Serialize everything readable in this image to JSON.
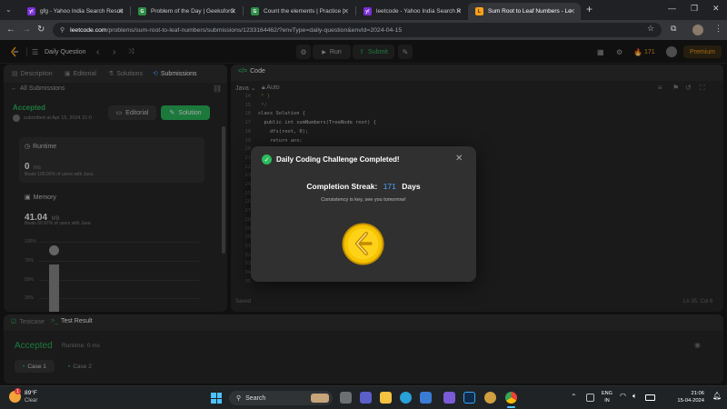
{
  "browser": {
    "tabs": [
      {
        "label": "gfg - Yahoo India Search Result",
        "fav_color": "#7b2fd6",
        "fav_text": "y!",
        "active": false
      },
      {
        "label": "Problem of the Day | GeeksforG",
        "fav_color": "#2f8d46",
        "fav_text": "G",
        "active": false
      },
      {
        "label": "Count the elements | Practice |",
        "fav_color": "#2f8d46",
        "fav_text": "G",
        "active": false
      },
      {
        "label": "leetcode - Yahoo India Search R",
        "fav_color": "#7b2fd6",
        "fav_text": "y!",
        "active": false
      },
      {
        "label": "Sum Root to Leaf Numbers - Le",
        "fav_color": "#ffa116",
        "fav_text": "L",
        "active": true
      }
    ],
    "new_tab": "+",
    "url_host": "leetcode.com",
    "url_path": "/problems/sum-root-to-leaf-numbers/submissions/1233164462/?envType=daily-question&envId=2024-04-15"
  },
  "lc_nav": {
    "daily_question": "Daily Question",
    "run": "Run",
    "submit": "Submit",
    "streak": "171",
    "premium": "Premium"
  },
  "left_panel": {
    "tabs": [
      "Description",
      "Editorial",
      "Solutions",
      "Submissions"
    ],
    "all_submissions": "All Submissions",
    "status": "Accepted",
    "submitted": "submitted at Apr 15, 2024 21:0",
    "editorial_btn": "Editorial",
    "solution_btn": "Solution",
    "runtime_label": "Runtime",
    "runtime_value": "0",
    "runtime_unit": "ms",
    "runtime_beats": "Beats 100.00% of users with Java",
    "memory_label": "Memory",
    "memory_value": "41.04",
    "memory_unit": "MB",
    "memory_beats": "Beats 50.97% of users with Java",
    "chart_ticks": [
      "100%",
      "75%",
      "50%",
      "25%"
    ]
  },
  "code_panel": {
    "title": "Code",
    "language": "Java",
    "auto": "Auto",
    "saved": "Saved",
    "cursor": "Ln 35, Col 6",
    "line_numbers": [
      "14",
      "15",
      "16",
      "17",
      "18",
      "19",
      "20",
      "21",
      "22",
      "23",
      "24",
      "25",
      "26",
      "27",
      "28",
      "29",
      "30",
      "31",
      "32",
      "33",
      "34",
      "35"
    ],
    "code_lines": [
      {
        "n": "14",
        "text": " * }"
      },
      {
        "n": "15",
        "text": " */"
      },
      {
        "n": "16",
        "text": "class Solution {"
      },
      {
        "n": "17",
        "text": "  public int sumNumbers(TreeNode root) {"
      },
      {
        "n": "18",
        "text": "    dfs(root, 0);"
      },
      {
        "n": "19",
        "text": "    return ans;"
      }
    ]
  },
  "bottom_panel": {
    "testcase_tab": "Testcase",
    "result_tab": "Test Result",
    "status": "Accepted",
    "runtime": "Runtime: 0 ms",
    "cases": [
      "Case 1",
      "Case 2"
    ]
  },
  "modal": {
    "title": "Daily Coding Challenge Completed!",
    "streak_label": "Completion Streak:",
    "streak_value": "171",
    "streak_unit": "Days",
    "message": "Consistency is key, see you tomorrow!",
    "close": "✕"
  },
  "taskbar": {
    "temp": "89°F",
    "weather": "Clear",
    "search": "Search",
    "lang_top": "ENG",
    "lang_bottom": "IN",
    "time": "21:06",
    "date": "15-04-2024",
    "weather_badge": "1"
  }
}
